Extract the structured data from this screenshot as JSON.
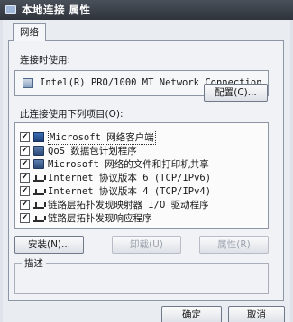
{
  "window": {
    "title": "本地连接 属性"
  },
  "tabs": [
    {
      "label": "网络"
    }
  ],
  "connect_using": {
    "label": "连接时使用:",
    "adapter_name": "Intel(R) PRO/1000 MT Network Connection",
    "configure_button": "配置(C)..."
  },
  "items_section": {
    "label": "此连接使用下列项目(O):",
    "items": [
      {
        "label": "Microsoft 网络客户端",
        "checked": true,
        "icon": "network-client-icon"
      },
      {
        "label": "QoS 数据包计划程序",
        "checked": true,
        "icon": "service-icon"
      },
      {
        "label": "Microsoft 网络的文件和打印机共享",
        "checked": true,
        "icon": "service-icon"
      },
      {
        "label": "Internet 协议版本 6 (TCP/IPv6)",
        "checked": true,
        "icon": "protocol-icon"
      },
      {
        "label": "Internet 协议版本 4 (TCP/IPv4)",
        "checked": true,
        "icon": "protocol-icon"
      },
      {
        "label": "链路层拓扑发现映射器 I/O 驱动程序",
        "checked": true,
        "icon": "protocol-icon"
      },
      {
        "label": "链路层拓扑发现响应程序",
        "checked": true,
        "icon": "protocol-icon"
      }
    ]
  },
  "buttons": {
    "install": "安装(N)...",
    "uninstall": "卸载(U)",
    "properties": "属性(R)",
    "ok": "确定",
    "cancel": "取消"
  },
  "description": {
    "title": "描述",
    "text": ""
  }
}
